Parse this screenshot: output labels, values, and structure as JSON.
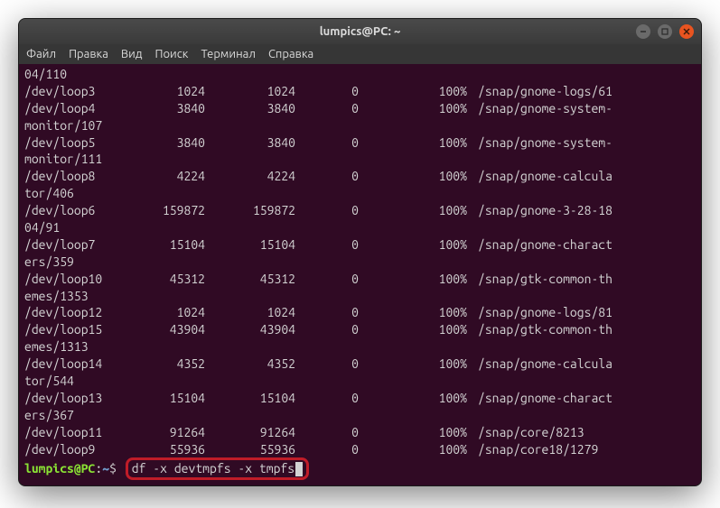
{
  "window": {
    "title": "lumpics@PC: ~"
  },
  "menu": {
    "file": "Файл",
    "edit": "Правка",
    "view": "Вид",
    "search": "Поиск",
    "terminal": "Терминал",
    "help": "Справка"
  },
  "output": {
    "line0": "04/110",
    "rows": [
      {
        "fs": "/dev/loop3",
        "size": "1024",
        "used": "1024",
        "avail": "0",
        "pct": "100%",
        "mount": "/snap/gnome-logs/61"
      },
      {
        "fs": "/dev/loop4",
        "size": "3840",
        "used": "3840",
        "avail": "0",
        "pct": "100%",
        "mount": "/snap/gnome-system-",
        "wrap": "monitor/107"
      },
      {
        "fs": "/dev/loop5",
        "size": "3840",
        "used": "3840",
        "avail": "0",
        "pct": "100%",
        "mount": "/snap/gnome-system-",
        "wrap": "monitor/111"
      },
      {
        "fs": "/dev/loop8",
        "size": "4224",
        "used": "4224",
        "avail": "0",
        "pct": "100%",
        "mount": "/snap/gnome-calcula",
        "wrap": "tor/406"
      },
      {
        "fs": "/dev/loop6",
        "size": "159872",
        "used": "159872",
        "avail": "0",
        "pct": "100%",
        "mount": "/snap/gnome-3-28-18",
        "wrap": "04/91"
      },
      {
        "fs": "/dev/loop7",
        "size": "15104",
        "used": "15104",
        "avail": "0",
        "pct": "100%",
        "mount": "/snap/gnome-charact",
        "wrap": "ers/359"
      },
      {
        "fs": "/dev/loop10",
        "size": "45312",
        "used": "45312",
        "avail": "0",
        "pct": "100%",
        "mount": "/snap/gtk-common-th",
        "wrap": "emes/1353"
      },
      {
        "fs": "/dev/loop12",
        "size": "1024",
        "used": "1024",
        "avail": "0",
        "pct": "100%",
        "mount": "/snap/gnome-logs/81"
      },
      {
        "fs": "/dev/loop15",
        "size": "43904",
        "used": "43904",
        "avail": "0",
        "pct": "100%",
        "mount": "/snap/gtk-common-th",
        "wrap": "emes/1313"
      },
      {
        "fs": "/dev/loop14",
        "size": "4352",
        "used": "4352",
        "avail": "0",
        "pct": "100%",
        "mount": "/snap/gnome-calcula",
        "wrap": "tor/544"
      },
      {
        "fs": "/dev/loop13",
        "size": "15104",
        "used": "15104",
        "avail": "0",
        "pct": "100%",
        "mount": "/snap/gnome-charact",
        "wrap": "ers/367"
      },
      {
        "fs": "/dev/loop11",
        "size": "91264",
        "used": "91264",
        "avail": "0",
        "pct": "100%",
        "mount": "/snap/core/8213"
      },
      {
        "fs": "/dev/loop9",
        "size": "55936",
        "used": "55936",
        "avail": "0",
        "pct": "100%",
        "mount": "/snap/core18/1279"
      }
    ]
  },
  "prompt": {
    "user_host": "lumpics@PC",
    "colon": ":",
    "path": "~",
    "dollar": "$",
    "command": "df -x devtmpfs -x tmpfs"
  }
}
